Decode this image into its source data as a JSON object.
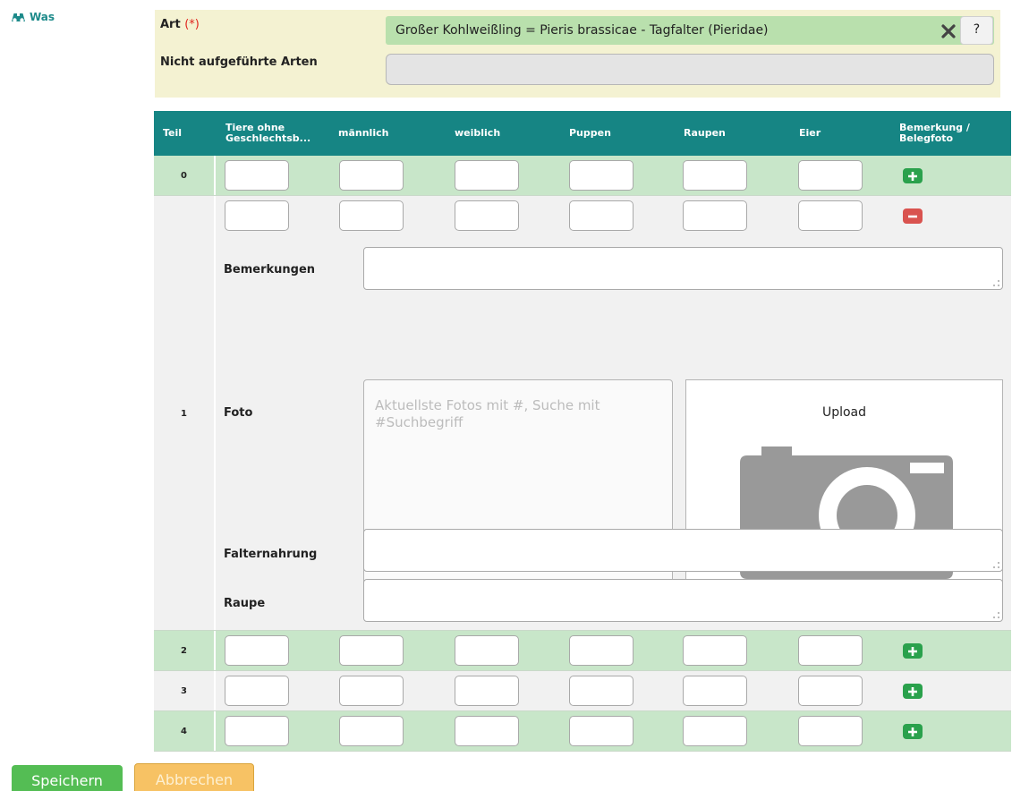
{
  "section": {
    "title": "Was",
    "icon": "binoculars-icon"
  },
  "species": {
    "art_label": "Art",
    "required_marker": "(*)",
    "selected_value": "Großer Kohlweißling = Pieris brassicae - Tagfalter (Pieridae)",
    "clear_icon": "close-icon",
    "help_label": "?",
    "unlisted_label": "Nicht aufgeführte Arten",
    "unlisted_value": ""
  },
  "table": {
    "headers": {
      "teil": "Teil",
      "tiere_line1": "Tiere ohne",
      "tiere_line2": "Geschlechtsb...",
      "maennlich": "männlich",
      "weiblich": "weiblich",
      "puppen": "Puppen",
      "raupen": "Raupen",
      "eier": "Eier",
      "bemerkung_line1": "Bemerkung /",
      "bemerkung_line2": "Belegfoto"
    },
    "rows": [
      {
        "num": "0",
        "action": "add"
      },
      {
        "num": "1",
        "action": "remove"
      },
      {
        "num": "2",
        "action": "add"
      },
      {
        "num": "3",
        "action": "add"
      },
      {
        "num": "4",
        "action": "add"
      }
    ],
    "detail": {
      "bemerkungen_label": "Bemerkungen",
      "foto_label": "Foto",
      "foto_search_placeholder": "Aktuellste Fotos mit #, Suche mit #Suchbegriff",
      "upload_label": "Upload",
      "upload_icon": "camera-icon",
      "falternahrung_label": "Falternahrung",
      "raupe_label": "Raupe"
    }
  },
  "buttons": {
    "save": "Speichern",
    "cancel": "Abbrechen"
  },
  "colors": {
    "header_teal": "#168584",
    "row_green": "#c8e6c9",
    "add_green": "#2aa14c",
    "remove_red": "#d9534f",
    "save_green": "#54bd54",
    "cancel_orange": "#f7c264"
  }
}
